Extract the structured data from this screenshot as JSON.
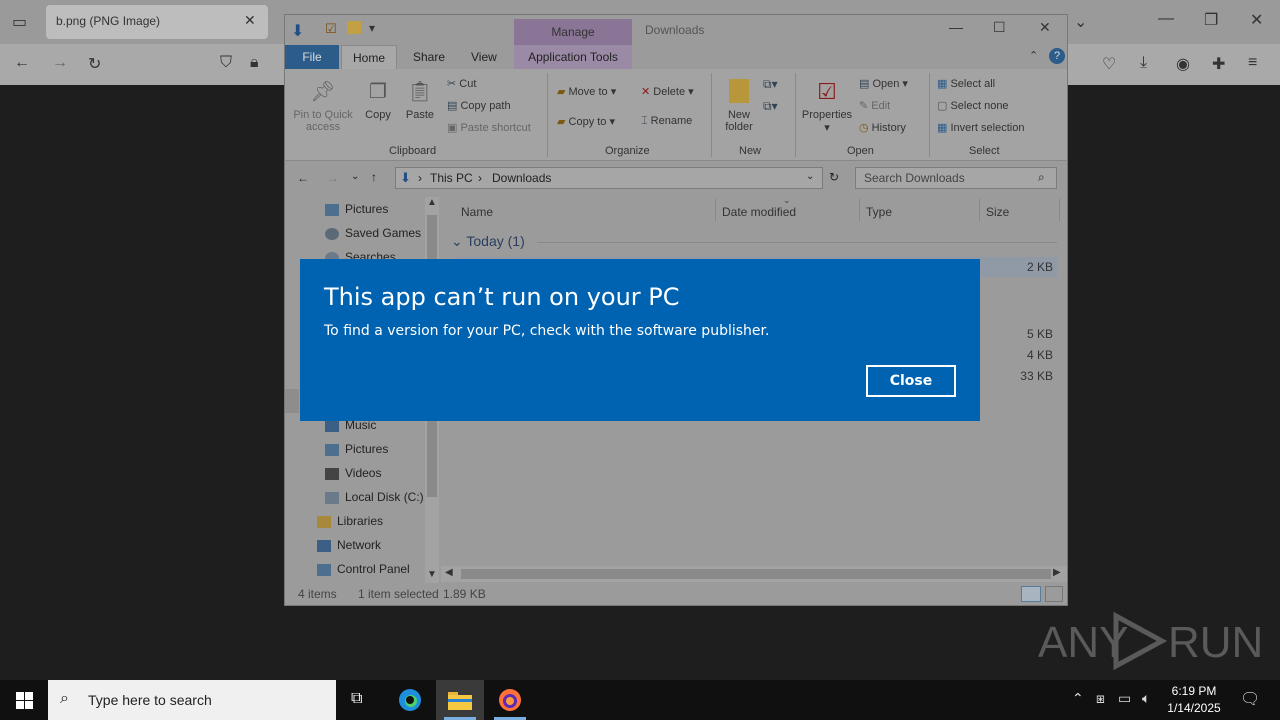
{
  "browser": {
    "tab_title": "b.png (PNG Image)",
    "tab_close": "✕",
    "nav_icons": [
      "back-icon",
      "forward-icon",
      "reload-icon",
      "shield-icon",
      "lock-icon"
    ]
  },
  "explorer": {
    "title": "Downloads",
    "manage_tab": "Manage",
    "tabs": {
      "file": "File",
      "home": "Home",
      "share": "Share",
      "view": "View",
      "app_tools": "Application Tools"
    },
    "ribbon": {
      "clipboard": {
        "label": "Clipboard",
        "pin": "Pin to Quick\naccess",
        "pin_line1": "Pin to Quick",
        "pin_line2": "access",
        "copy": "Copy",
        "paste": "Paste",
        "cut": "Cut",
        "copy_path": "Copy path",
        "paste_shortcut": "Paste shortcut"
      },
      "organize": {
        "label": "Organize",
        "move_to": "Move to",
        "copy_to": "Copy to",
        "delete": "Delete",
        "rename": "Rename"
      },
      "new": {
        "label": "New",
        "new_folder_1": "New",
        "new_folder_2": "folder"
      },
      "open": {
        "label": "Open",
        "properties": "Properties",
        "open": "Open",
        "edit": "Edit",
        "history": "History"
      },
      "select": {
        "label": "Select",
        "select_all": "Select all",
        "select_none": "Select none",
        "invert": "Invert selection"
      }
    },
    "address": {
      "this_pc": "This PC",
      "downloads": "Downloads",
      "search_placeholder": "Search Downloads"
    },
    "nav_top": [
      "Pictures",
      "Saved Games",
      "Searches"
    ],
    "nav_bottom": [
      "Music",
      "Pictures",
      "Videos",
      "Local Disk (C:)",
      "Libraries",
      "Network",
      "Control Panel"
    ],
    "columns": {
      "name": "Name",
      "date": "Date modified",
      "type": "Type",
      "size": "Size"
    },
    "group": "Today (1)",
    "sizes": [
      "2 KB",
      "5 KB",
      "4 KB",
      "33 KB"
    ],
    "status": {
      "items": "4 items",
      "selected": "1 item selected",
      "size": "1.89 KB"
    }
  },
  "dialog": {
    "title": "This app can’t run on your PC",
    "message": "To find a version for your PC, check with the software publisher.",
    "close": "Close"
  },
  "watermark": {
    "left": "ANY",
    "right": "RUN"
  },
  "taskbar": {
    "search_placeholder": "Type here to search",
    "time": "6:19 PM",
    "date": "1/14/2025"
  }
}
